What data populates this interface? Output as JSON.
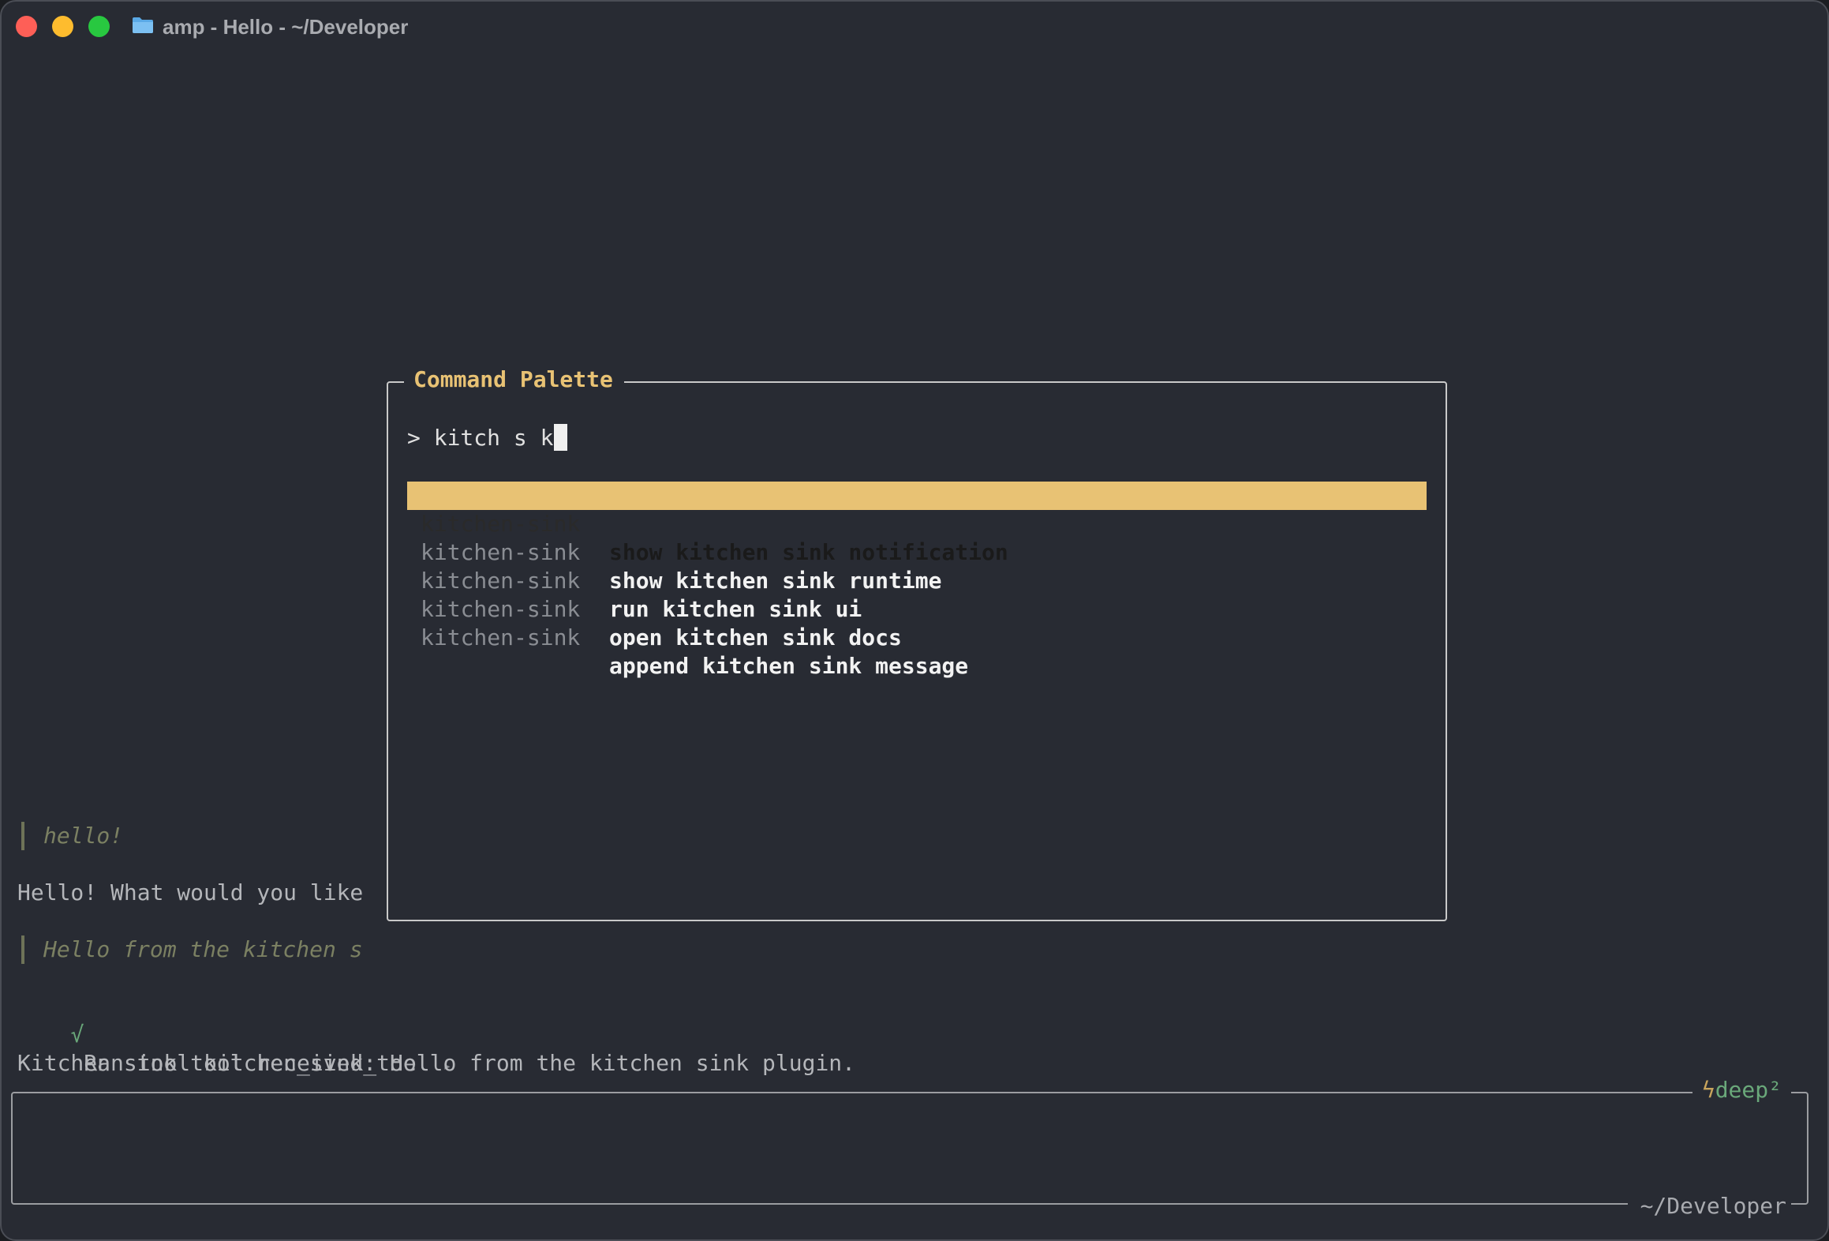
{
  "window": {
    "title": "amp - Hello - ~/Developer"
  },
  "conversation": {
    "user_message_1": "hello!",
    "assistant_message_1": "Hello! What would you like",
    "user_message_2": "Hello from the kitchen s",
    "tool_status_icon": "√",
    "tool_run_label": "Ran tool kitchen_sink_tool",
    "tool_expand_icon": "▸",
    "tool_result": "Kitchen sink tool received: Hello from the kitchen sink plugin."
  },
  "command_palette": {
    "title": "Command Palette",
    "prompt_symbol": ">",
    "query": "kitch s k",
    "results": [
      {
        "category": "kitchen-sink",
        "label": "show kitchen sink notification",
        "selected": true
      },
      {
        "category": "kitchen-sink",
        "label": "show kitchen sink runtime",
        "selected": false
      },
      {
        "category": "kitchen-sink",
        "label": "run kitchen sink ui",
        "selected": false
      },
      {
        "category": "kitchen-sink",
        "label": "open kitchen sink docs",
        "selected": false
      },
      {
        "category": "kitchen-sink",
        "label": "append kitchen sink message",
        "selected": false
      }
    ]
  },
  "input": {
    "mode_icon": "ϟ",
    "mode_label": "deep²",
    "cwd": "~/Developer"
  },
  "colors": {
    "accent": "#e8c274",
    "background": "#282b33",
    "success": "#6aa87a"
  }
}
